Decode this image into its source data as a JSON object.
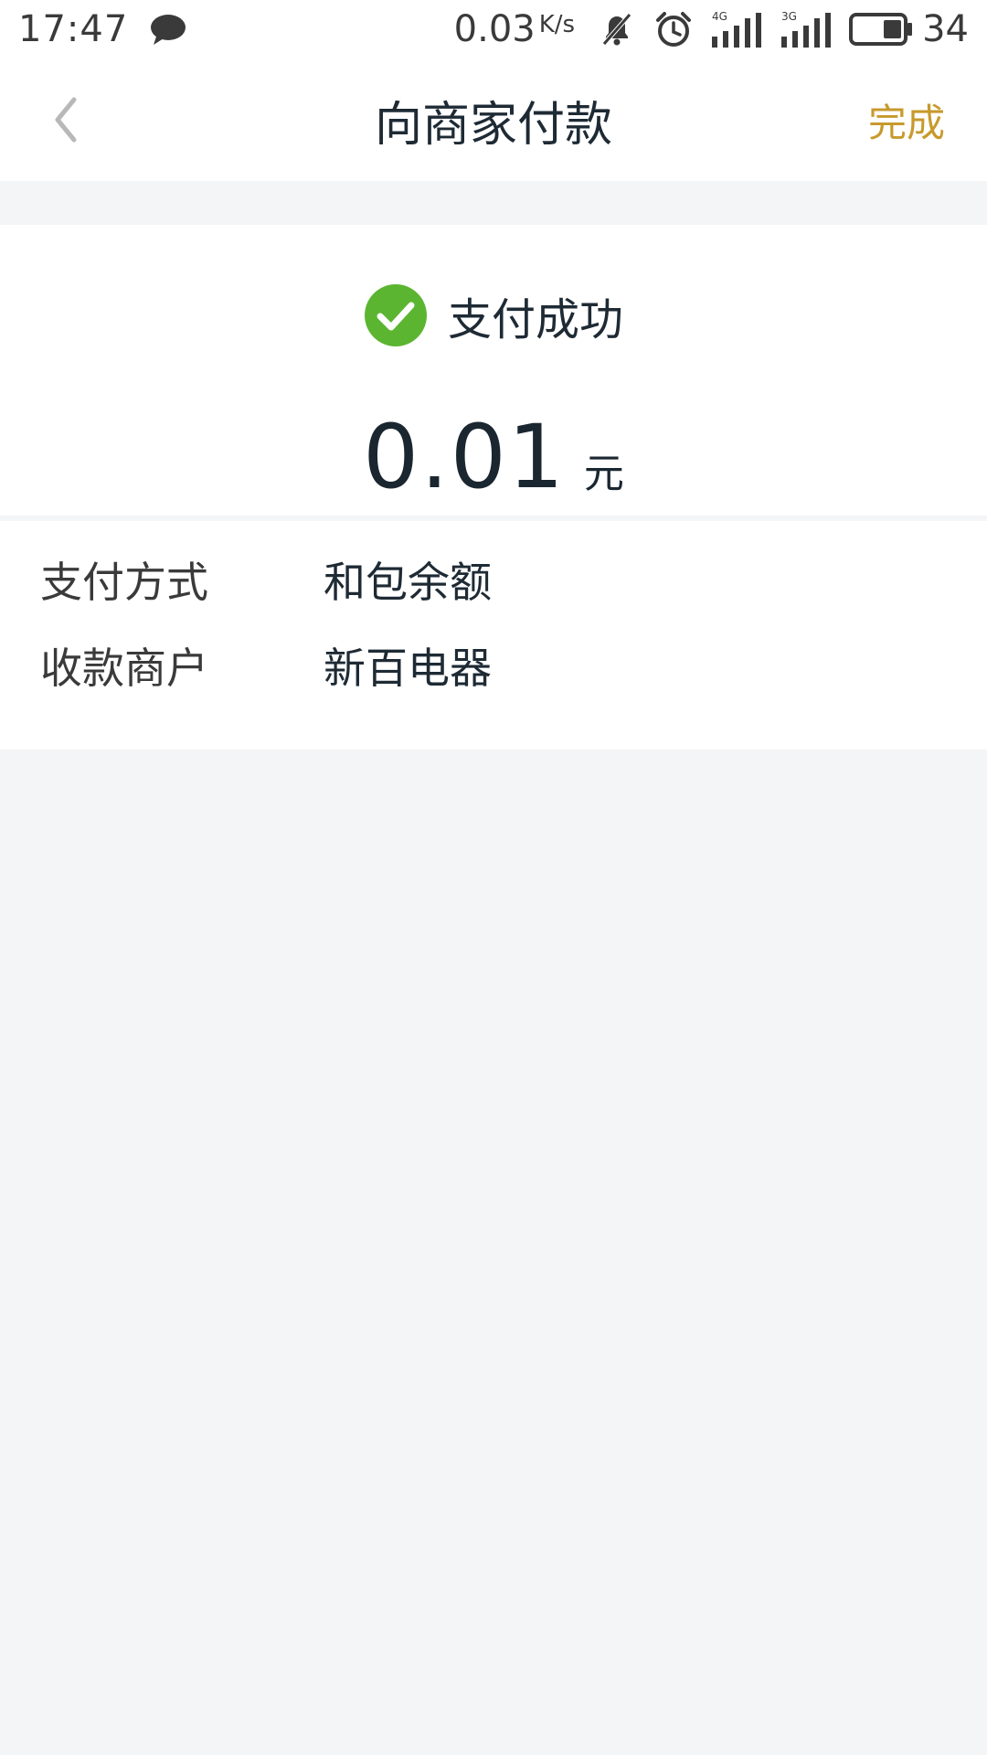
{
  "status_bar": {
    "time": "17:47",
    "net_speed": "0.03",
    "net_speed_unit": "K/s",
    "battery_level": "34",
    "icons": [
      "message-icon",
      "mute-icon",
      "alarm-icon",
      "signal-4g-icon",
      "signal-3g-icon",
      "battery-icon"
    ],
    "signal_labels": [
      "4G",
      "3G"
    ]
  },
  "nav": {
    "title": "向商家付款",
    "done_label": "完成",
    "back_icon": "chevron-left-icon"
  },
  "result": {
    "status_text": "支付成功",
    "amount": "0.01",
    "unit": "元",
    "icon": "check-circle-icon"
  },
  "details": [
    {
      "label": "支付方式",
      "value": "和包余额"
    },
    {
      "label": "收款商户",
      "value": "新百电器"
    }
  ],
  "colors": {
    "accent": "#c79a2c",
    "success": "#5cb531",
    "background": "#f4f5f7"
  }
}
